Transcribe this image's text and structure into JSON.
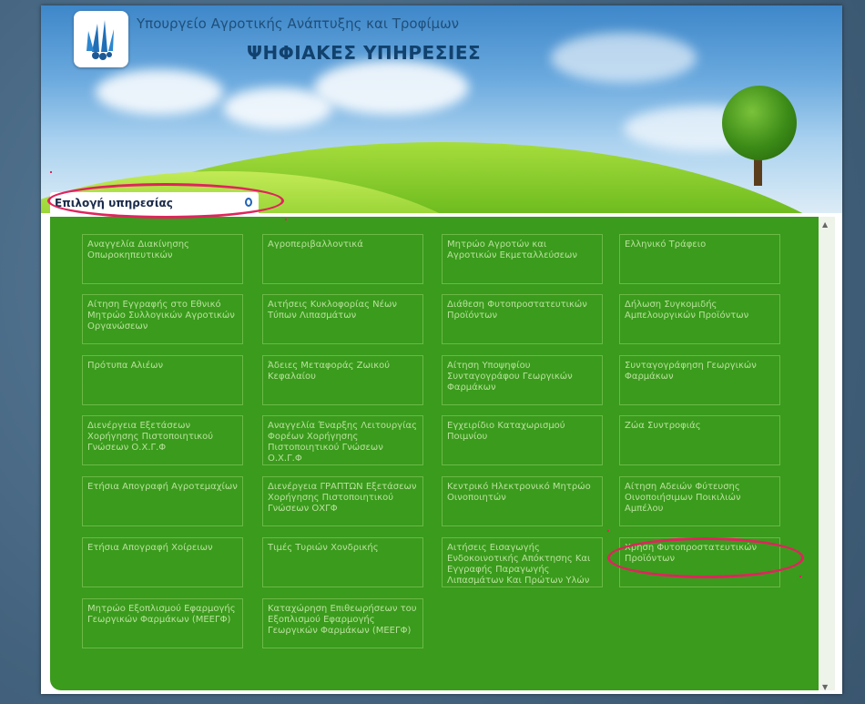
{
  "header": {
    "ministry": "Υπουργείο Αγροτικής Ανάπτυξης και Τροφίμων",
    "title": "ΨΗΦΙΑΚΕΣ ΥΠΗΡΕΣΙΕΣ"
  },
  "selector": {
    "label": "Επιλογή υπηρεσίας"
  },
  "services": [
    "Αναγγελία Διακίνησης Οπωροκηπευτικών",
    "Αγροπεριβαλλοντικά",
    "Μητρώο Αγροτών και Αγροτικών Εκμεταλλεύσεων",
    "Ελληνικό Τράφειο",
    "Αίτηση Εγγραφής στο Εθνικό Μητρώο Συλλογικών Αγροτικών Οργανώσεων",
    "Αιτήσεις Κυκλοφορίας Νέων Τύπων Λιπασμάτων",
    "Διάθεση Φυτοπροστατευτικών Προϊόντων",
    "Δήλωση Συγκομιδής Αμπελουργικών Προϊόντων",
    "Πρότυπα Αλιέων",
    "Άδειες Μεταφοράς Ζωικού Κεφαλαίου",
    "Αίτηση Υποψηφίου Συνταγογράφου Γεωργικών Φαρμάκων",
    "Συνταγογράφηση Γεωργικών Φαρμάκων",
    "Διενέργεια Εξετάσεων Χορήγησης Πιστοποιητικού Γνώσεων Ο.Χ.Γ.Φ",
    "Αναγγελία Έναρξης Λειτουργίας Φορέων Χορήγησης Πιστοποιητικού Γνώσεων Ο.Χ.Γ.Φ",
    "Εγχειρίδιο Καταχωρισμού Ποιμνίου",
    "Ζώα Συντροφιάς",
    "Ετήσια Απογραφή Αγροτεμαχίων",
    "Διενέργεια ΓΡΑΠΤΩΝ Εξετάσεων Χορήγησης Πιστοποιητικού Γνώσεων ΟΧΓΦ",
    "Κεντρικό Ηλεκτρονικό Μητρώο Οινοποιητών",
    "Αίτηση Αδειών Φύτευσης Οινοποιήσιμων Ποικιλιών Αμπέλου",
    "Ετήσια Απογραφή Χοίρειων",
    "Τιμές Τυριών Χονδρικής",
    "Αιτήσεις Εισαγωγής Ενδοκοινοτικής Απόκτησης Και Εγγραφής Παραγωγής Λιπασμάτων Και Πρώτων Υλών",
    "Χρήση Φυτοπροστατευτικών Προϊόντων",
    "Μητρώο Εξοπλισμού Εφαρμογής Γεωργικών Φαρμάκων (ΜΕΕΓΦ)",
    "Καταχώρηση Επιθεωρήσεων του Εξοπλισμού Εφαρμογής Γεωργικών Φαρμάκων (ΜΕΕΓΦ)"
  ],
  "colors": {
    "panel": "#3a9b1c",
    "tile_text": "#b9e19d",
    "highlight": "#e0245e"
  }
}
